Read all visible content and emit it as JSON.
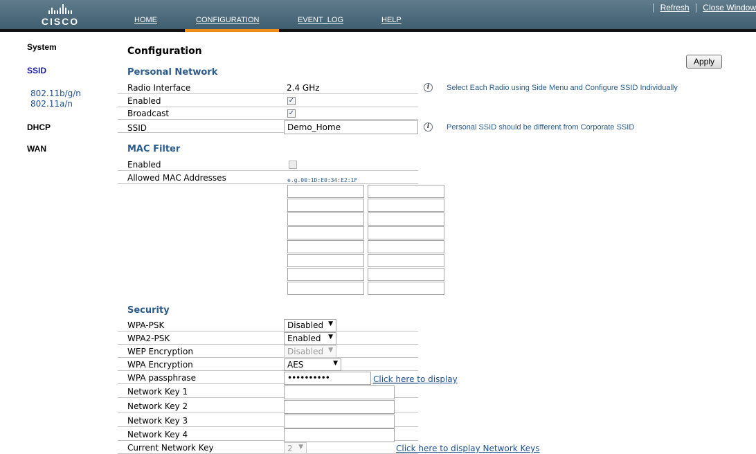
{
  "header": {
    "logo_text": "CISCO",
    "nav": [
      "HOME",
      "CONFIGURATION",
      "EVENT_LOG",
      "HELP"
    ],
    "active_nav": "CONFIGURATION",
    "refresh_label": "Refresh",
    "close_window_label": "Close Window"
  },
  "sidebar": {
    "system": "System",
    "ssid": "SSID",
    "radio_bgn": "802.11b/g/n",
    "radio_an": "802.11a/n",
    "dhcp": "DHCP",
    "wan": "WAN"
  },
  "main": {
    "title": "Configuration",
    "apply_label": "Apply",
    "personal_network": {
      "title": "Personal Network",
      "radio_interface_label": "Radio Interface",
      "radio_interface_value": "2.4 GHz",
      "radio_info": "Select Each Radio using Side Menu and Configure SSID Individually",
      "enabled_label": "Enabled",
      "enabled_checked": true,
      "broadcast_label": "Broadcast",
      "broadcast_checked": true,
      "ssid_label": "SSID",
      "ssid_value": "Demo_Home",
      "ssid_info": "Personal SSID should be different from Corporate SSID"
    },
    "mac_filter": {
      "title": "MAC Filter",
      "enabled_label": "Enabled",
      "enabled_checked": false,
      "allowed_label": "Allowed MAC Addresses",
      "hint": "e.g.00:1D:E0:34:E2:1F",
      "rows": 8,
      "columns": 2
    },
    "security": {
      "title": "Security",
      "wpa_psk_label": "WPA-PSK",
      "wpa_psk_value": "Disabled",
      "wpa2_psk_label": "WPA2-PSK",
      "wpa2_psk_value": "Enabled",
      "wep_label": "WEP Encryption",
      "wep_value": "Disabled",
      "wpa_enc_label": "WPA Encryption",
      "wpa_enc_value": "AES",
      "passphrase_label": "WPA passphrase",
      "passphrase_value": "••••••••••",
      "display_link": "Click here to display",
      "key1_label": "Network Key 1",
      "key2_label": "Network Key 2",
      "key3_label": "Network Key 3",
      "key4_label": "Network Key 4",
      "current_key_label": "Current Network Key",
      "current_key_value": "2",
      "display_keys_link": "Click here to display Network Keys"
    }
  },
  "colors": {
    "header": "#4f6d7f",
    "nav_active": "#f08c1a",
    "section_title": "#2a5b8c",
    "link": "#1d4f91"
  }
}
